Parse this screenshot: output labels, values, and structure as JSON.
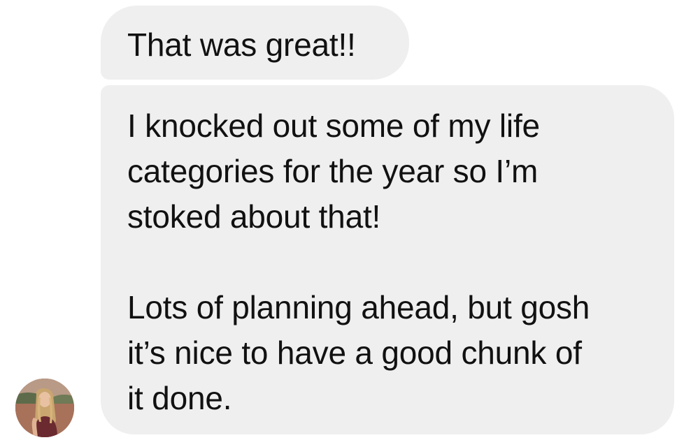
{
  "conversation": {
    "messages": [
      {
        "text": "That was great!!"
      },
      {
        "text": "I knocked out some of my life\ncategories for the year so I’m\nstoked about that!\n\nLots of planning ahead, but gosh\nit’s nice to have a good chunk of\nit done."
      }
    ],
    "sender": {
      "avatar_icon": "user-avatar-photo"
    }
  },
  "colors": {
    "bubble_background": "#efefef",
    "text": "#111111",
    "page_background": "#ffffff"
  }
}
